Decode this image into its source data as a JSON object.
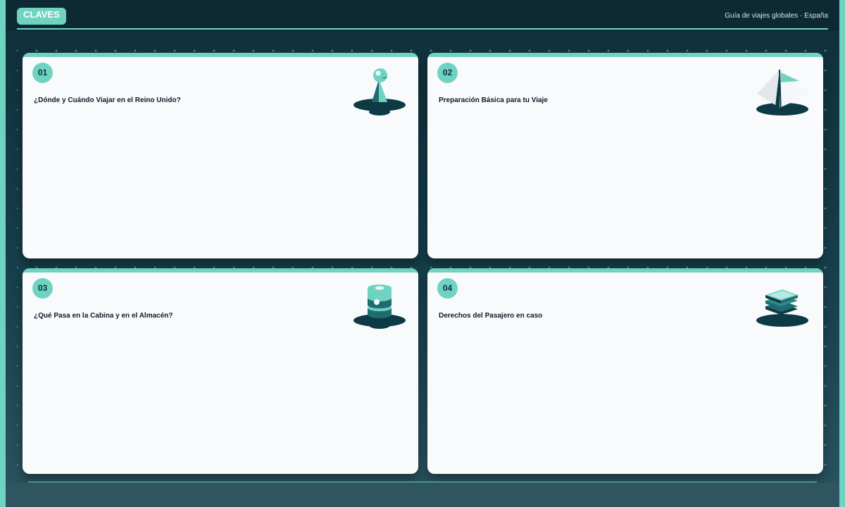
{
  "header": {
    "badge": "CLAVES",
    "meta": "Guía de viajes globales · España"
  },
  "cards": [
    {
      "number": "01",
      "title": "¿Dónde y Cuándo Viajar en el Reino Unido?",
      "icon": "sailboat-icon"
    },
    {
      "number": "02",
      "title": "Preparación Básica para tu Viaje",
      "icon": "tent-icon"
    },
    {
      "number": "03",
      "title": "¿Qué Pasa en la Cabina y en el Almacén?",
      "icon": "coin-stack-icon"
    },
    {
      "number": "04",
      "title": "Derechos del Pasajero en caso",
      "icon": "book-stack-icon"
    }
  ],
  "colors": {
    "accent": "#6fd3c1",
    "background_dark": "#0f2f3a",
    "card": "#f8fafc"
  }
}
